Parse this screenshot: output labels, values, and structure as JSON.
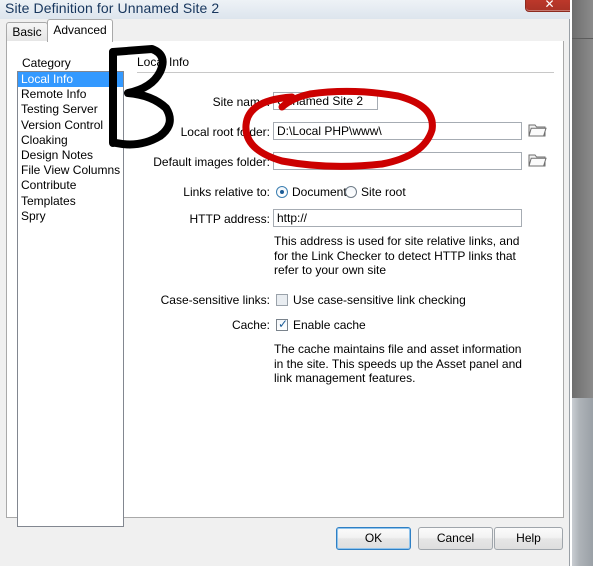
{
  "window": {
    "title": "Site Definition for Unnamed Site 2",
    "close_glyph": "✕"
  },
  "tabs": [
    {
      "label": "Basic",
      "active": false
    },
    {
      "label": "Advanced",
      "active": true
    }
  ],
  "category": {
    "label": "Category",
    "items": [
      {
        "label": "Local Info",
        "selected": true
      },
      {
        "label": "Remote Info",
        "selected": false
      },
      {
        "label": "Testing Server",
        "selected": false
      },
      {
        "label": "Version Control",
        "selected": false
      },
      {
        "label": "Cloaking",
        "selected": false
      },
      {
        "label": "Design Notes",
        "selected": false
      },
      {
        "label": "File View Columns",
        "selected": false
      },
      {
        "label": "Contribute",
        "selected": false
      },
      {
        "label": "Templates",
        "selected": false
      },
      {
        "label": "Spry",
        "selected": false
      }
    ]
  },
  "section": {
    "title": "Local Info"
  },
  "fields": {
    "site_name": {
      "label": "Site name:",
      "value": "Unnamed Site 2"
    },
    "local_root_folder": {
      "label": "Local root folder:",
      "value": "D:\\Local PHP\\www\\",
      "browse_icon": "folder-icon"
    },
    "default_images_folder": {
      "label": "Default images folder:",
      "value": "",
      "browse_icon": "folder-icon"
    },
    "links_relative_to": {
      "label": "Links relative to:",
      "options": [
        {
          "label": "Document",
          "selected": true
        },
        {
          "label": "Site root",
          "selected": false
        }
      ]
    },
    "http_address": {
      "label": "HTTP address:",
      "value": "http://",
      "help": "This address is used for site relative links, and for the Link Checker to detect HTTP links that refer to your own site"
    },
    "case_sensitive_links": {
      "label": "Case-sensitive links:",
      "checkbox_label": "Use case-sensitive link checking",
      "checked": false
    },
    "cache": {
      "label": "Cache:",
      "checkbox_label": "Enable cache",
      "checked": true,
      "help": "The cache maintains file and asset information in the site.  This speeds up the Asset panel and link management features."
    }
  },
  "buttons": {
    "ok": "OK",
    "cancel": "Cancel",
    "help": "Help"
  },
  "colors": {
    "selection_blue": "#3399ff",
    "title_text": "#17365d",
    "annotation_red": "#cc0000",
    "annotation_black": "#000000",
    "close_red": "#c0392b"
  },
  "annotations": {
    "red_ellipse_name": "red-ellipse-highlight",
    "black_bracket_name": "black-bracket-mark"
  }
}
